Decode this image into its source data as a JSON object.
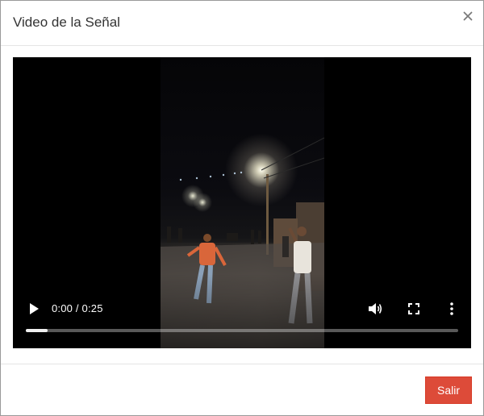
{
  "modal": {
    "title": "Video de la Señal",
    "close_icon": "close-icon"
  },
  "video": {
    "current_time": "0:00",
    "duration": "0:25",
    "time_display": "0:00 / 0:25",
    "progress_fraction": 0.05,
    "icons": [
      "play-icon",
      "volume-icon",
      "fullscreen-icon",
      "more-options-icon"
    ]
  },
  "footer": {
    "exit_label": "Salir",
    "exit_color": "#dd4b39"
  }
}
